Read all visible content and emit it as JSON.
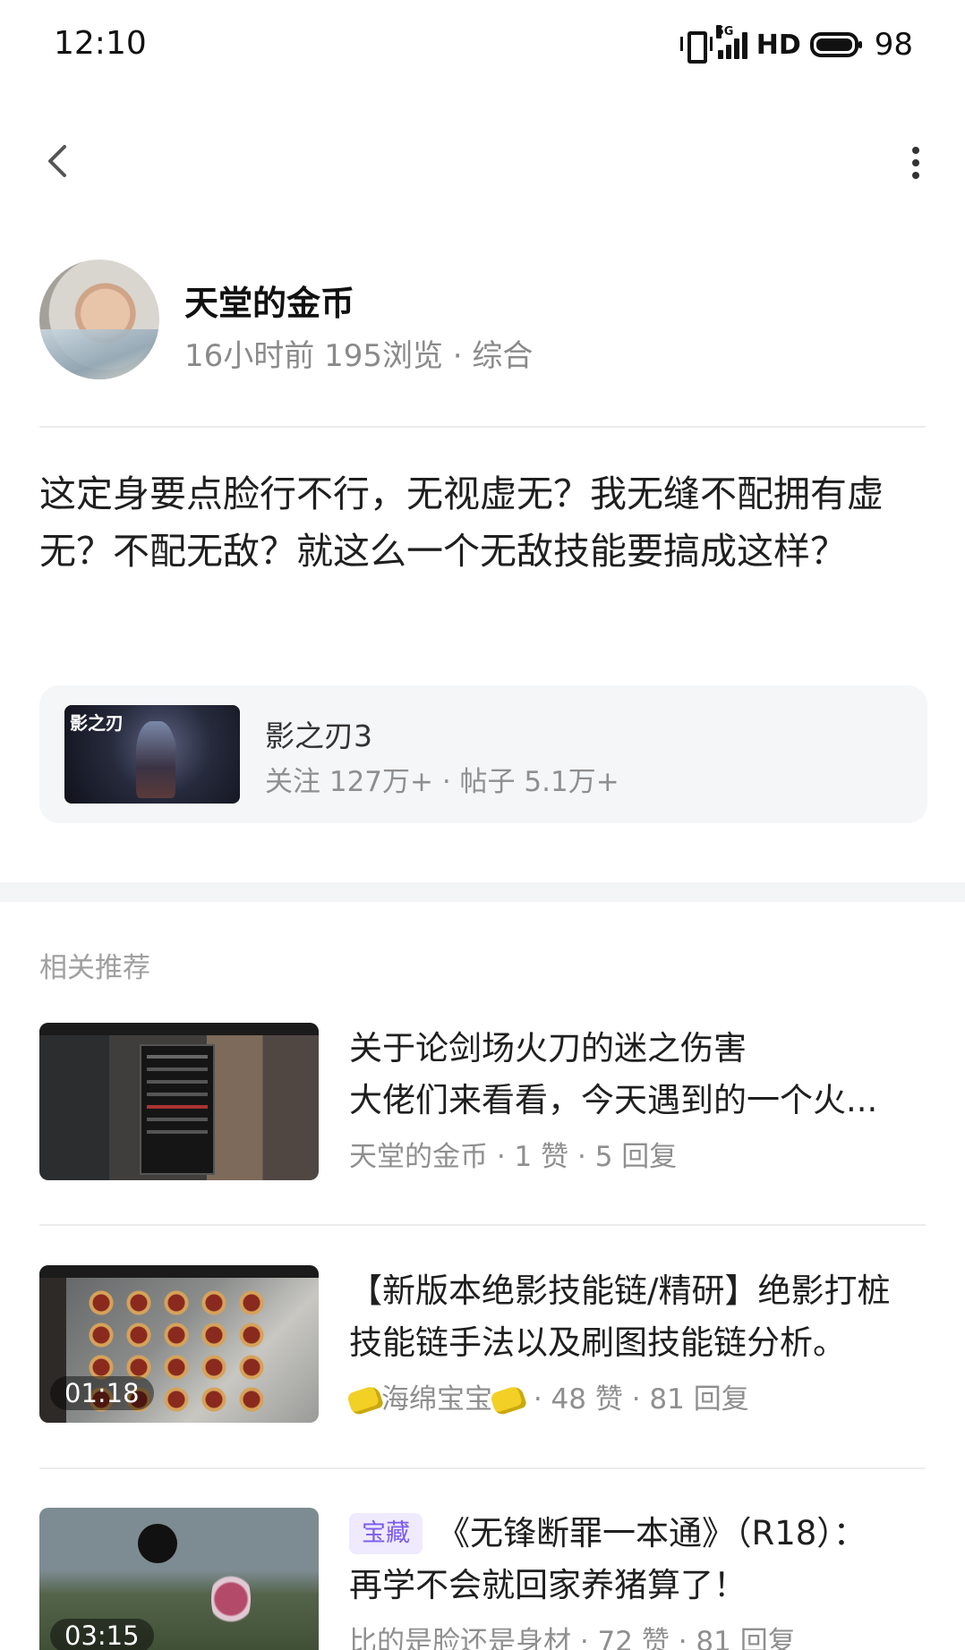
{
  "status_bar": {
    "time": "12:10",
    "network": "5G",
    "hd": "HD",
    "battery": "98"
  },
  "nav": {
    "back_icon": "chevron-left-icon",
    "more_icon": "more-vertical-icon"
  },
  "author": {
    "name": "天堂的金币",
    "meta": "16小时前  195浏览 · 综合"
  },
  "post": {
    "text": "这定身要点脸行不行，无视虚无？我无缝不配拥有虚无？不配无敌？就这么一个无敌技能要搞成这样？"
  },
  "forum": {
    "logo": "影之刃",
    "name": "影之刃3",
    "stats": "关注 127万+ · 帖子 5.1万+"
  },
  "section": {
    "title": "相关推荐"
  },
  "recommendations": [
    {
      "title_line1": "关于论剑场火刀的迷之伤害",
      "title_line2": "大佬们来看看，今天遇到的一个火...",
      "meta": "天堂的金币 · 1 赞 · 5 回复",
      "duration": ""
    },
    {
      "title_line1": "【新版本绝影技能链/精研】绝影打桩",
      "title_line2": "技能链手法以及刷图技能链分析。",
      "author": "海绵宝宝",
      "meta": " · 48 赞 · 81 回复",
      "duration": "01:18"
    },
    {
      "tag": "宝藏",
      "title_line1": "《无锋断罪一本通》（R18）：",
      "title_line2": "再学不会就回家养猪算了！",
      "meta": "比的是脸还是身材 · 72 赞 · 81 回复",
      "duration": "03:15"
    }
  ]
}
